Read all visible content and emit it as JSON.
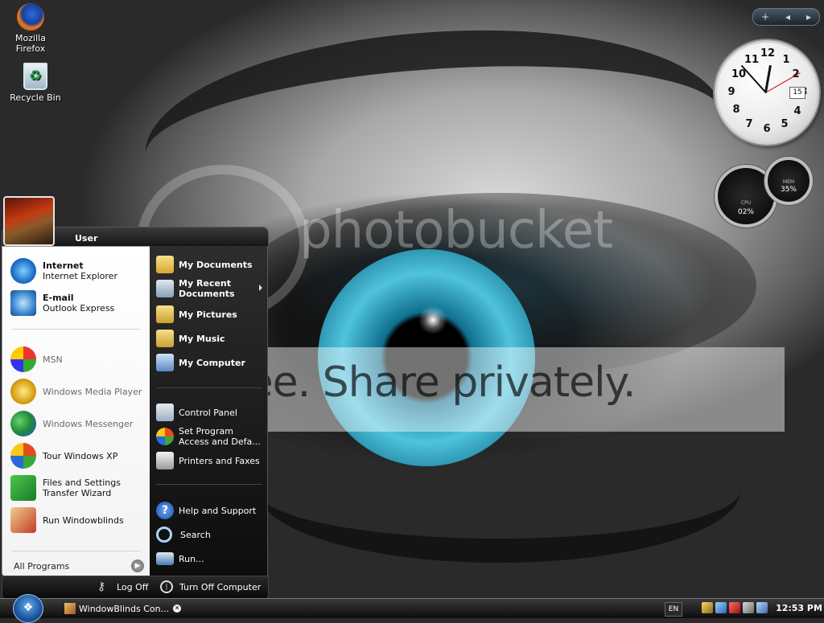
{
  "desktop": {
    "icons": [
      {
        "label": "Mozilla Firefox",
        "icon": "firefox-icon"
      },
      {
        "label": "Recycle Bin",
        "icon": "recycle-bin-icon"
      }
    ],
    "watermark": {
      "brand": "photobucket",
      "tagline": "Join free. Share privately."
    }
  },
  "gadgets": {
    "clock": {
      "numbers": [
        "12",
        "1",
        "2",
        "3",
        "4",
        "5",
        "6",
        "7",
        "8",
        "9",
        "10",
        "11"
      ],
      "date": "15",
      "time": "12:53"
    },
    "cpu_meter": {
      "cpu_label": "CPU",
      "cpu_value": "02%",
      "mem_label": "MEM",
      "mem_value": "35%"
    },
    "sidebar_controls": {
      "add": "+",
      "prev": "◂",
      "next": "▸"
    }
  },
  "start_menu": {
    "user_name": "User",
    "pinned": [
      {
        "title": "Internet",
        "subtitle": "Internet Explorer",
        "icon": "internet-explorer-icon"
      },
      {
        "title": "E-mail",
        "subtitle": "Outlook Express",
        "icon": "outlook-express-icon"
      }
    ],
    "recent": [
      {
        "label": "MSN",
        "icon": "msn-icon",
        "dimmed": true
      },
      {
        "label": "Windows Media Player",
        "icon": "media-player-icon",
        "dimmed": true
      },
      {
        "label": "Windows Messenger",
        "icon": "messenger-icon",
        "dimmed": true
      },
      {
        "label": "Tour Windows XP",
        "icon": "tour-icon",
        "dimmed": false
      },
      {
        "label": "Files and Settings Transfer Wizard",
        "line1": "Files and Settings",
        "line2": "Transfer Wizard",
        "icon": "transfer-wizard-icon",
        "dimmed": false
      },
      {
        "label": "Run Windowblinds",
        "icon": "windowblinds-icon",
        "dimmed": false
      }
    ],
    "all_programs": "All Programs",
    "places": [
      {
        "label": "My Documents",
        "icon": "folder-documents-icon"
      },
      {
        "label": "My Recent Documents",
        "line1": "My Recent",
        "line2": "Documents",
        "icon": "recent-documents-icon",
        "has_submenu": true
      },
      {
        "label": "My Pictures",
        "icon": "folder-pictures-icon"
      },
      {
        "label": "My Music",
        "icon": "folder-music-icon"
      },
      {
        "label": "My Computer",
        "icon": "computer-icon"
      }
    ],
    "settings": [
      {
        "label": "Control Panel",
        "icon": "control-panel-icon"
      },
      {
        "label": "Set Program Access and Defaults",
        "line1": "Set Program",
        "line2": "Access and Defa...",
        "icon": "program-defaults-icon"
      },
      {
        "label": "Printers and Faxes",
        "icon": "printer-icon"
      }
    ],
    "help": [
      {
        "label": "Help and Support",
        "icon": "help-icon"
      },
      {
        "label": "Search",
        "icon": "search-icon"
      },
      {
        "label": "Run...",
        "icon": "run-icon"
      }
    ],
    "footer": {
      "log_off": "Log Off",
      "turn_off": "Turn Off Computer"
    }
  },
  "taskbar": {
    "task_button": "WindowBlinds Con...",
    "language": "EN",
    "clock": "12:53 PM"
  },
  "colors": {
    "menu_dark": "#111111",
    "menu_light": "#ffffff",
    "taskbar": "#1a1a1a",
    "iris": "#4fc3dd"
  }
}
